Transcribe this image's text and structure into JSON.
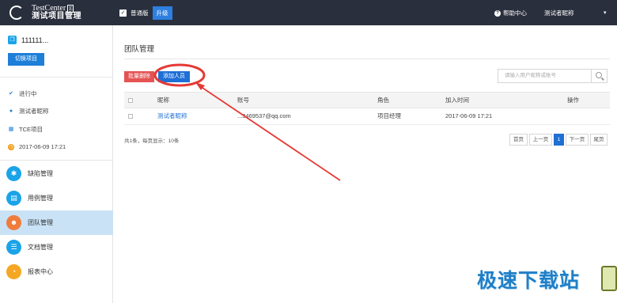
{
  "header": {
    "logo_en": "TestCenter",
    "logo_badge": "E",
    "logo_cn": "测试项目管理",
    "edition_label": "普通版",
    "upgrade_label": "升级",
    "help_label": "帮助中心",
    "user_nickname": "测试者昵称"
  },
  "sidebar": {
    "project_name": "111111...",
    "switch_label": "切换项目",
    "info": [
      {
        "icon": "check-circle-icon",
        "text": "进行中"
      },
      {
        "icon": "person-icon",
        "text": "测试者昵称"
      },
      {
        "icon": "grid-icon",
        "text": "TCE项目"
      },
      {
        "icon": "clock-icon",
        "text": "2017-06-09 17:21"
      }
    ],
    "nav": [
      {
        "label": "缺陷管理",
        "icon": "bug-icon",
        "color": "#1aa3e8",
        "active": false
      },
      {
        "label": "用例管理",
        "icon": "document-icon",
        "color": "#1aa3e8",
        "active": false
      },
      {
        "label": "团队管理",
        "icon": "team-icon",
        "color": "#f07c3c",
        "active": true
      },
      {
        "label": "文档管理",
        "icon": "docs-icon",
        "color": "#1aa3e8",
        "active": false
      },
      {
        "label": "报表中心",
        "icon": "chart-icon",
        "color": "#f5a623",
        "active": false
      }
    ]
  },
  "main": {
    "title": "团队管理",
    "batch_delete_label": "批量删除",
    "add_member_label": "添加人员",
    "search_placeholder": "请输入用户昵称或账号",
    "table": {
      "headers": {
        "nickname": "昵称",
        "account": "账号",
        "role": "角色",
        "joined": "加入时间",
        "actions": "操作"
      },
      "rows": [
        {
          "nickname": "测试者昵称",
          "account": "...3469537@qq.com",
          "role": "项目经理",
          "joined": "2017-06-09 17:21"
        }
      ]
    },
    "summary": "共1条，每页显示：10条",
    "pagination": {
      "first": "首页",
      "prev": "上一页",
      "current": "1",
      "next": "下一页",
      "last": "尾页"
    }
  },
  "watermark": "极速下载站",
  "colors": {
    "accent": "#1e6fd6",
    "danger": "#e55353",
    "annotation": "#e53935",
    "topbar": "#2a2f3d"
  }
}
